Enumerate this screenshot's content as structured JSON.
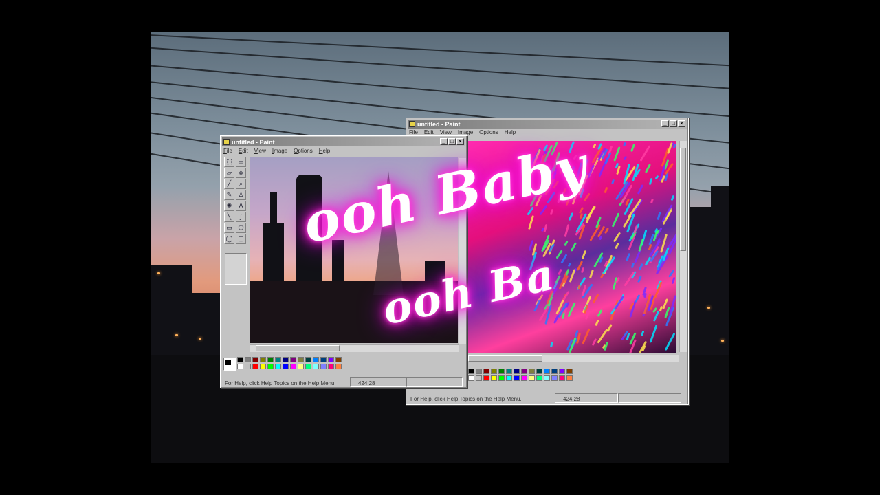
{
  "window_front": {
    "title": "untitled - Paint",
    "menu": [
      "File",
      "Edit",
      "View",
      "Image",
      "Options",
      "Help"
    ],
    "status_help": "For Help, click Help Topics on the Help Menu.",
    "coords": "424,28"
  },
  "window_back": {
    "title": "untitled - Paint",
    "menu": [
      "File",
      "Edit",
      "View",
      "Image",
      "Options",
      "Help"
    ],
    "status_help": "For Help, click Help Topics on the Help Menu.",
    "coords": "424,28"
  },
  "title_buttons": {
    "minimize": "_",
    "maximize": "□",
    "close": "×"
  },
  "tools": [
    {
      "icon": "free-select-icon",
      "glyph": "⬚"
    },
    {
      "icon": "rect-select-icon",
      "glyph": "▭"
    },
    {
      "icon": "eraser-icon",
      "glyph": "▱"
    },
    {
      "icon": "fill-icon",
      "glyph": "◈"
    },
    {
      "icon": "color-picker-icon",
      "glyph": "╱"
    },
    {
      "icon": "magnifier-icon",
      "glyph": "⌕"
    },
    {
      "icon": "pencil-icon",
      "glyph": "✎"
    },
    {
      "icon": "brush-icon",
      "glyph": "♙"
    },
    {
      "icon": "airbrush-icon",
      "glyph": "✺"
    },
    {
      "icon": "text-icon",
      "glyph": "A"
    },
    {
      "icon": "line-icon",
      "glyph": "╲"
    },
    {
      "icon": "curve-icon",
      "glyph": "∫"
    },
    {
      "icon": "rectangle-icon",
      "glyph": "▭"
    },
    {
      "icon": "polygon-icon",
      "glyph": "⬠"
    },
    {
      "icon": "ellipse-icon",
      "glyph": "◯"
    },
    {
      "icon": "rounded-rect-icon",
      "glyph": "▢"
    }
  ],
  "palette": [
    "#000000",
    "#808080",
    "#800000",
    "#808000",
    "#008000",
    "#008080",
    "#000080",
    "#800080",
    "#808040",
    "#004040",
    "#0080ff",
    "#004080",
    "#8000ff",
    "#804000",
    "#ffffff",
    "#c0c0c0",
    "#ff0000",
    "#ffff00",
    "#00ff00",
    "#00ffff",
    "#0000ff",
    "#ff00ff",
    "#ffff80",
    "#00ff80",
    "#80ffff",
    "#8080ff",
    "#ff0080",
    "#ff8040"
  ],
  "overlay_text": {
    "line1": "ooh Baby",
    "line2": "ooh Ba"
  }
}
